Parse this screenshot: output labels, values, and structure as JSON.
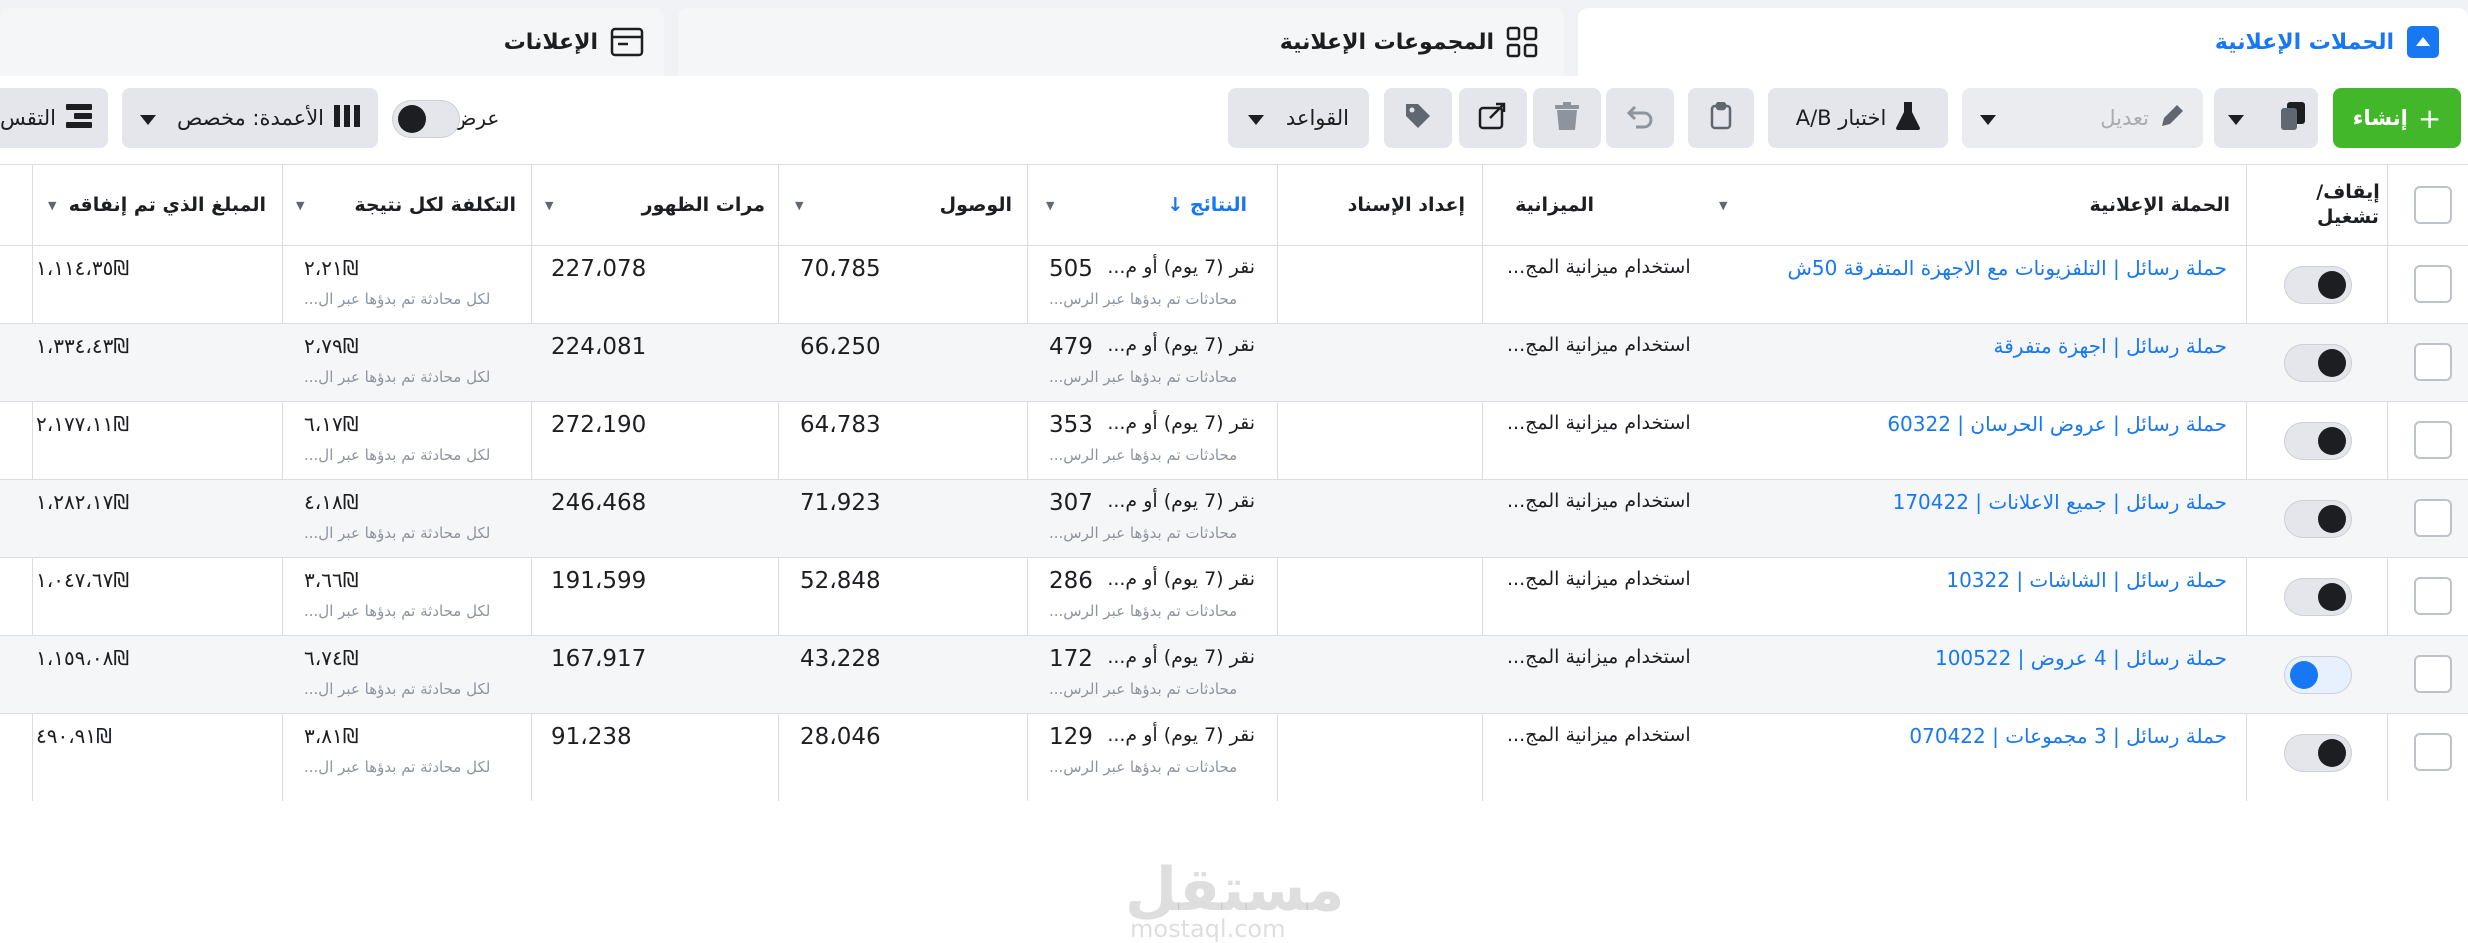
{
  "tabs": {
    "campaigns": "الحملات الإعلانية",
    "adsets": "المجموعات الإعلانية",
    "ads": "الإعلانات"
  },
  "toolbar": {
    "create": "إنشاء",
    "edit": "تعديل",
    "ab_test": "اختبار A/B",
    "rules": "القواعد",
    "view_setup": "عرض الإعداد",
    "columns": "الأعمدة: مخصص",
    "breakdown": "التقس"
  },
  "columns": {
    "toggle": "إيقاف/ تشغيل",
    "campaign": "الحملة الإعلانية",
    "budget": "الميزانية",
    "attribution": "إعداد الإسناد",
    "results": "النتائج ↓",
    "reach": "الوصول",
    "impressions": "مرات الظهور",
    "cost_per_result": "التكلفة لكل نتيجة",
    "amount_spent": "المبلغ الذي تم إنفاقه"
  },
  "rows": [
    {
      "on": false,
      "campaign": "حملة رسائل | التلفزيونات مع الاجهزة المتفرقة 50ش",
      "budget": "استخدام ميزانية المج...",
      "attribution": "نقر (7 يوم) أو م...",
      "results": "505",
      "results_sub": "محادثات تم بدؤها عبر الرس...",
      "reach": "70،785",
      "impressions": "227،078",
      "cost": "٢،٢١₪",
      "cost_sub": "لكل محادثة تم بدؤها عبر ال...",
      "spent": "١،١١٤،٣٥₪"
    },
    {
      "on": false,
      "campaign": "حملة رسائل | اجهزة متفرقة",
      "budget": "استخدام ميزانية المج...",
      "attribution": "نقر (7 يوم) أو م...",
      "results": "479",
      "results_sub": "محادثات تم بدؤها عبر الرس...",
      "reach": "66،250",
      "impressions": "224،081",
      "cost": "٢،٧٩₪",
      "cost_sub": "لكل محادثة تم بدؤها عبر ال...",
      "spent": "١،٣٣٤،٤٣₪"
    },
    {
      "on": false,
      "campaign": "حملة رسائل | عروض الحرسان | 60322",
      "budget": "استخدام ميزانية المج...",
      "attribution": "نقر (7 يوم) أو م...",
      "results": "353",
      "results_sub": "محادثات تم بدؤها عبر الرس...",
      "reach": "64،783",
      "impressions": "272،190",
      "cost": "٦،١٧₪",
      "cost_sub": "لكل محادثة تم بدؤها عبر ال...",
      "spent": "٢،١٧٧،١١₪"
    },
    {
      "on": false,
      "campaign": "حملة رسائل | جميع الاعلانات | 170422",
      "budget": "استخدام ميزانية المج...",
      "attribution": "نقر (7 يوم) أو م...",
      "results": "307",
      "results_sub": "محادثات تم بدؤها عبر الرس...",
      "reach": "71،923",
      "impressions": "246،468",
      "cost": "٤،١٨₪",
      "cost_sub": "لكل محادثة تم بدؤها عبر ال...",
      "spent": "١،٢٨٢،١٧₪"
    },
    {
      "on": false,
      "campaign": "حملة رسائل | الشاشات | 10322",
      "budget": "استخدام ميزانية المج...",
      "attribution": "نقر (7 يوم) أو م...",
      "results": "286",
      "results_sub": "محادثات تم بدؤها عبر الرس...",
      "reach": "52،848",
      "impressions": "191،599",
      "cost": "٣،٦٦₪",
      "cost_sub": "لكل محادثة تم بدؤها عبر ال...",
      "spent": "١،٠٤٧،٦٧₪"
    },
    {
      "on": true,
      "campaign": "حملة رسائل | 4 عروض | 100522",
      "budget": "استخدام ميزانية المج...",
      "attribution": "نقر (7 يوم) أو م...",
      "results": "172",
      "results_sub": "محادثات تم بدؤها عبر الرس...",
      "reach": "43،228",
      "impressions": "167،917",
      "cost": "٦،٧٤₪",
      "cost_sub": "لكل محادثة تم بدؤها عبر ال...",
      "spent": "١،١٥٩،٠٨₪"
    },
    {
      "on": false,
      "campaign": "حملة رسائل | 3 مجموعات | 070422",
      "budget": "استخدام ميزانية المج...",
      "attribution": "نقر (7 يوم) أو م...",
      "results": "129",
      "results_sub": "محادثات تم بدؤها عبر الرس...",
      "reach": "28،046",
      "impressions": "91،238",
      "cost": "٣،٨١₪",
      "cost_sub": "لكل محادثة تم بدؤها عبر ال...",
      "spent": "٤٩٠،٩١₪"
    }
  ],
  "watermark": {
    "main": "مستقل",
    "sub": "mostaql.com"
  },
  "colors": {
    "accent": "#1877f2",
    "create": "#42b72a"
  }
}
